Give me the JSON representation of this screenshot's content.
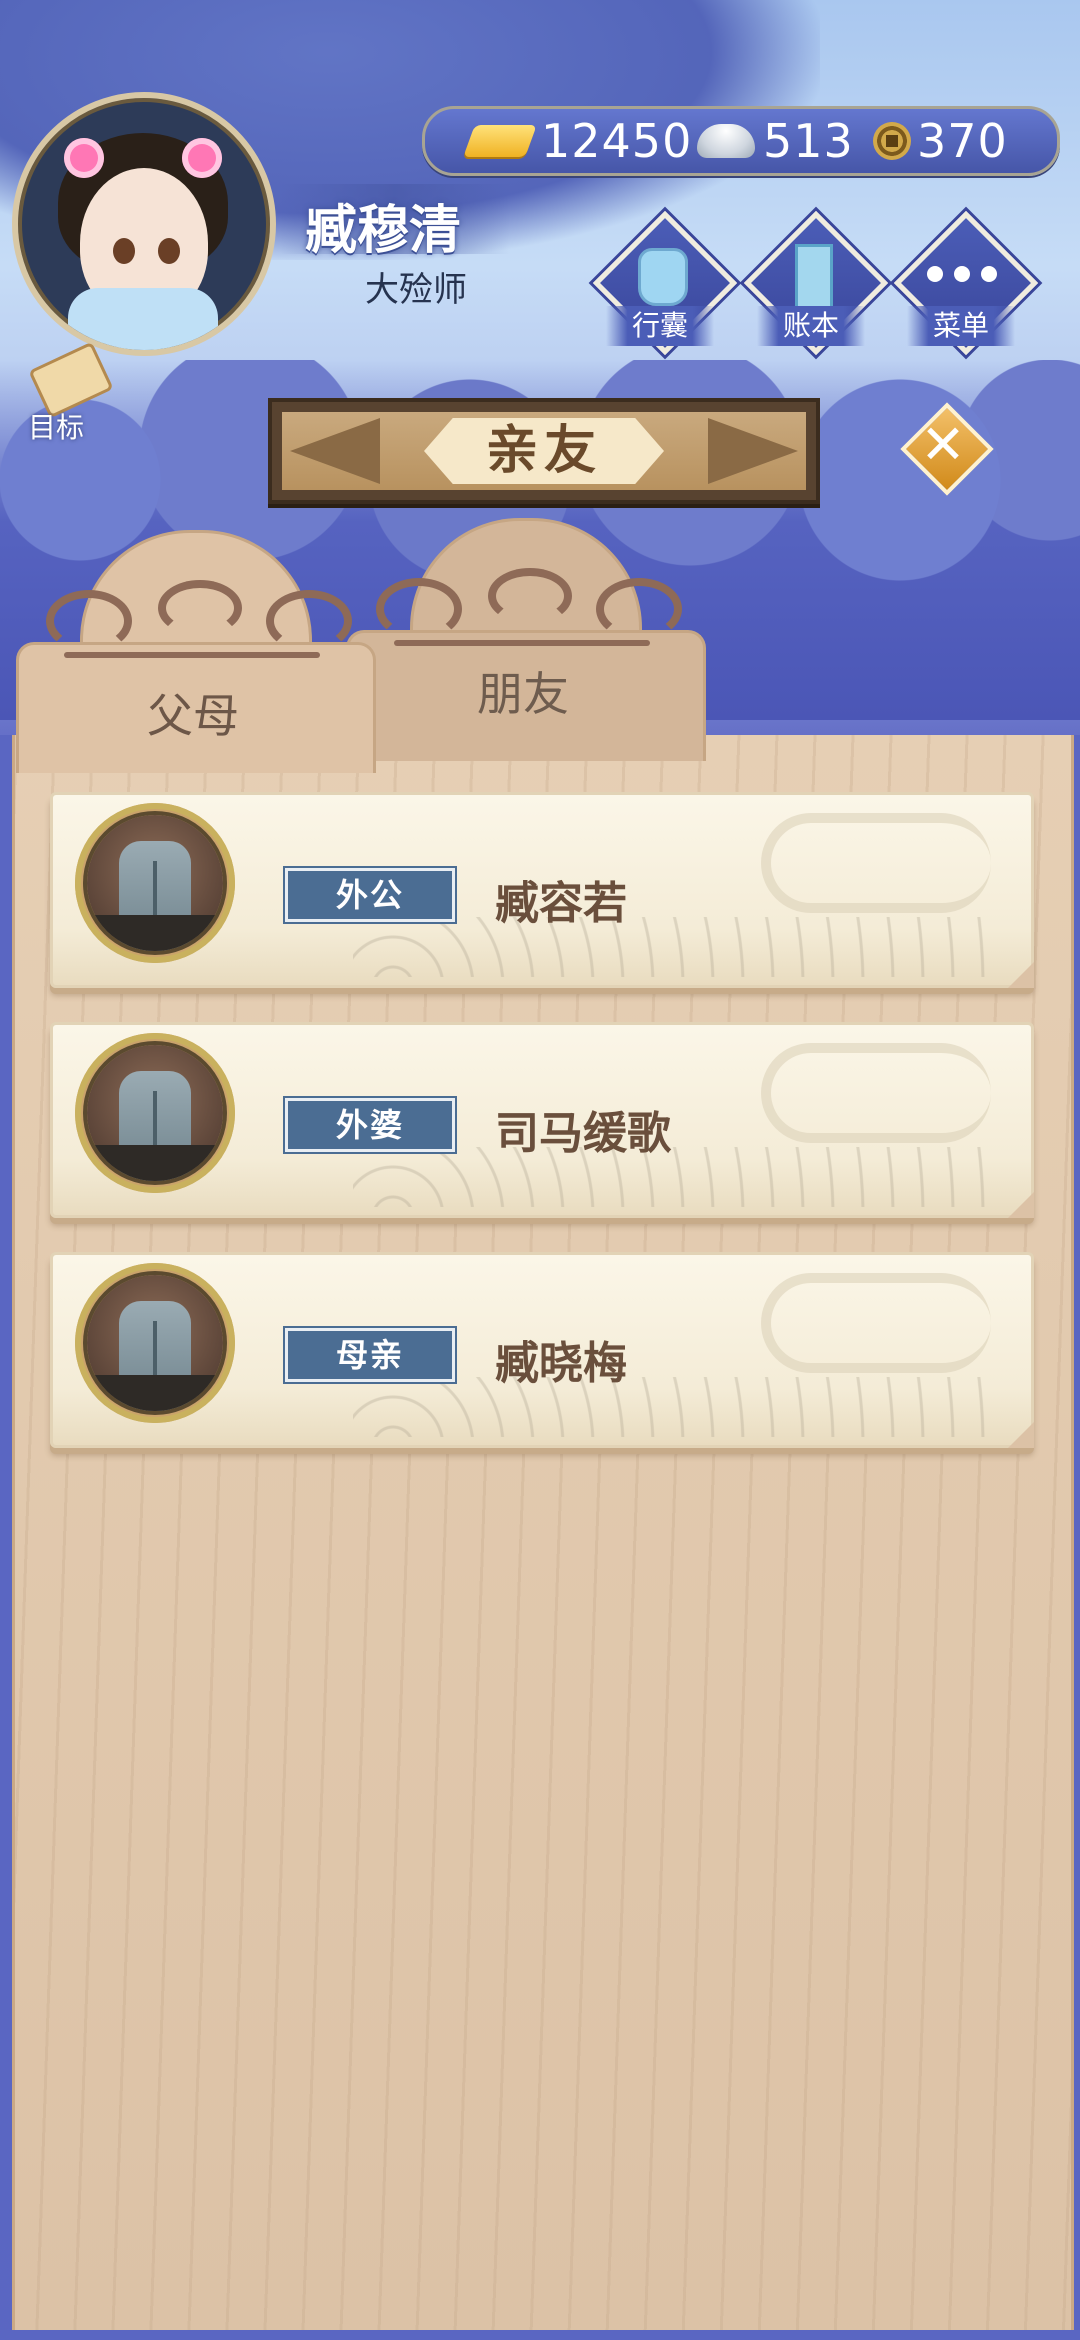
{
  "header": {
    "player_name": "臧穆清",
    "player_title": "大殓师",
    "currency": {
      "gold": "12450",
      "silver": "513",
      "coin": "370"
    },
    "menu": [
      {
        "label": "行囊",
        "icon": "bag-icon"
      },
      {
        "label": "账本",
        "icon": "ledger-icon"
      },
      {
        "label": "菜单",
        "icon": "more-dots-icon"
      }
    ],
    "goal_label": "目标"
  },
  "page": {
    "title": "亲友"
  },
  "tabs": [
    {
      "label": "父母",
      "active": true
    },
    {
      "label": "朋友",
      "active": false
    }
  ],
  "relatives": [
    {
      "role": "外公",
      "name": "臧容若",
      "portrait": "tombstone-icon"
    },
    {
      "role": "外婆",
      "name": "司马缓歌",
      "portrait": "tombstone-icon"
    },
    {
      "role": "母亲",
      "name": "臧晓梅",
      "portrait": "tombstone-icon"
    }
  ],
  "colors": {
    "accent_blue": "#4b5db7",
    "tag_blue": "#4b6d93",
    "panel": "#dfc3a6",
    "close_orange": "#e3a33c"
  }
}
